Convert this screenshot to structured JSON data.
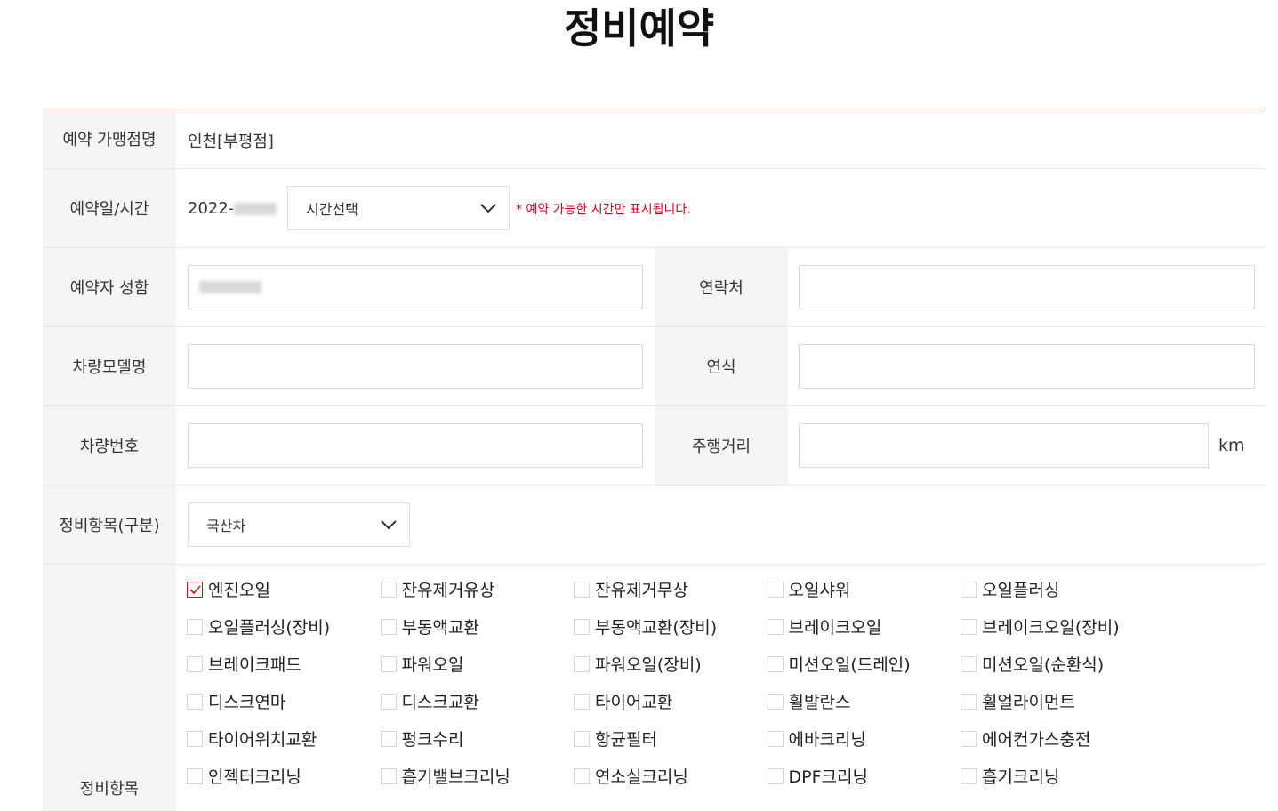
{
  "page": {
    "title": "정비예약"
  },
  "store": {
    "label": "예약 가맹점명",
    "value": "인천[부평점]"
  },
  "datetime": {
    "label": "예약일/시간",
    "date_prefix": "2022-",
    "time_select": "시간선택",
    "notice": "* 예약 가능한 시간만 표시됩니다."
  },
  "name": {
    "label": "예약자 성함",
    "value": ""
  },
  "contact": {
    "label": "연락처",
    "value": ""
  },
  "car_model": {
    "label": "차량모델명",
    "value": ""
  },
  "car_year": {
    "label": "연식",
    "value": ""
  },
  "car_number": {
    "label": "차량번호",
    "value": ""
  },
  "mileage": {
    "label": "주행거리",
    "value": "",
    "unit": "km"
  },
  "category": {
    "label": "정비항목(구분)",
    "selected": "국산차"
  },
  "service_items": {
    "label": "정비항목",
    "items": [
      {
        "label": "엔진오일",
        "checked": true
      },
      {
        "label": "잔유제거유상",
        "checked": false
      },
      {
        "label": "잔유제거무상",
        "checked": false
      },
      {
        "label": "오일샤워",
        "checked": false
      },
      {
        "label": "오일플러싱",
        "checked": false
      },
      {
        "label": "오일플러싱(장비)",
        "checked": false
      },
      {
        "label": "부동액교환",
        "checked": false
      },
      {
        "label": "부동액교환(장비)",
        "checked": false
      },
      {
        "label": "브레이크오일",
        "checked": false
      },
      {
        "label": "브레이크오일(장비)",
        "checked": false
      },
      {
        "label": "브레이크패드",
        "checked": false
      },
      {
        "label": "파워오일",
        "checked": false
      },
      {
        "label": "파워오일(장비)",
        "checked": false
      },
      {
        "label": "미션오일(드레인)",
        "checked": false
      },
      {
        "label": "미션오일(순환식)",
        "checked": false
      },
      {
        "label": "디스크연마",
        "checked": false
      },
      {
        "label": "디스크교환",
        "checked": false
      },
      {
        "label": "타이어교환",
        "checked": false
      },
      {
        "label": "휠발란스",
        "checked": false
      },
      {
        "label": "휠얼라이먼트",
        "checked": false
      },
      {
        "label": "타이어위치교환",
        "checked": false
      },
      {
        "label": "펑크수리",
        "checked": false
      },
      {
        "label": "항균필터",
        "checked": false
      },
      {
        "label": "에바크리닝",
        "checked": false
      },
      {
        "label": "에어컨가스충전",
        "checked": false
      },
      {
        "label": "인젝터크리닝",
        "checked": false
      },
      {
        "label": "흡기밸브크리닝",
        "checked": false
      },
      {
        "label": "연소실크리닝",
        "checked": false
      },
      {
        "label": "DPF크리닝",
        "checked": false
      },
      {
        "label": "흡기크리닝",
        "checked": false
      }
    ]
  },
  "colors": {
    "accent": "#b01c1c",
    "notice": "#d0021b",
    "label_bg": "#f5f5f5"
  }
}
